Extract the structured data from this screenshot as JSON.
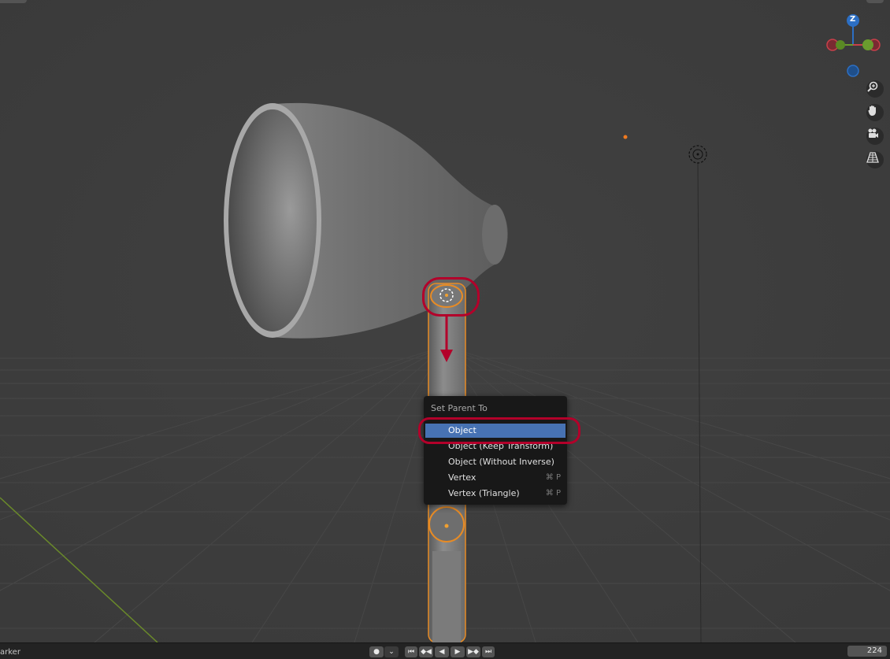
{
  "context_menu": {
    "title": "Set Parent To",
    "items": [
      {
        "label": "Object",
        "shortcut": "",
        "active": true
      },
      {
        "label": "Object (Keep Transform)",
        "shortcut": "",
        "active": false
      },
      {
        "label": "Object (Without Inverse)",
        "shortcut": "",
        "active": false
      },
      {
        "label": "Vertex",
        "shortcut": "⌘ P",
        "active": false
      },
      {
        "label": "Vertex (Triangle)",
        "shortcut": "⌘ P",
        "active": false
      }
    ]
  },
  "gizmo": {
    "z_label": "Z"
  },
  "nav_icons": [
    "zoom-icon",
    "hand-pan-icon",
    "camera-icon",
    "grid-perspective-icon"
  ],
  "timeline": {
    "left_label": "arker",
    "frame": "224",
    "playback_icons": [
      "jump-start",
      "prev-keyframe",
      "play-reverse",
      "play",
      "next-keyframe",
      "jump-end"
    ]
  },
  "colors": {
    "viewport_bg": "#3d3d3d",
    "menu_bg": "#181818",
    "menu_active": "#4772b3",
    "annotation": "#b3002a",
    "selection": "#e88b24",
    "axis_x": "#c9404a",
    "axis_y": "#6a9c2e",
    "axis_z": "#2c6fc4"
  }
}
